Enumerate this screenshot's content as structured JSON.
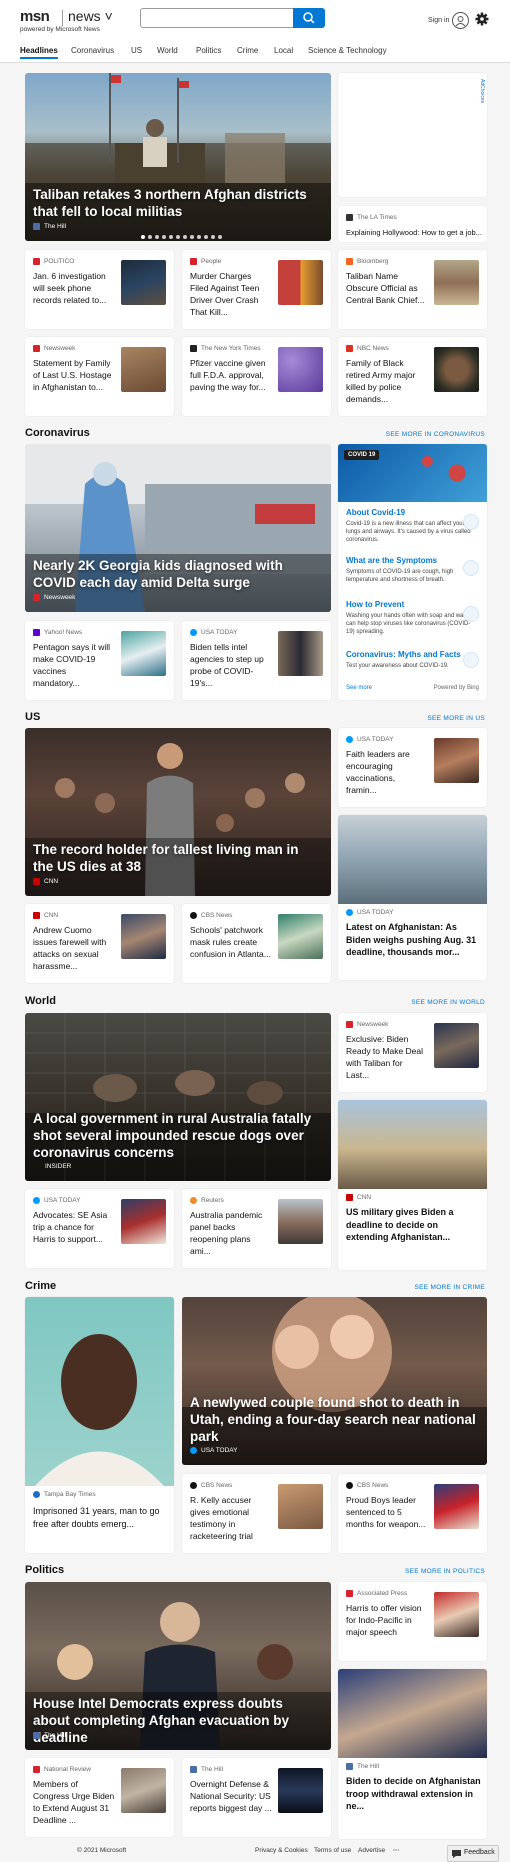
{
  "header": {
    "logo_msn": "msn",
    "logo_news": "news ˅",
    "powered": "powered by Microsoft News",
    "search_value": "",
    "signin": "Sign in"
  },
  "nav": [
    "Headlines",
    "Coronavirus",
    "US",
    "World",
    "Politics",
    "Crime",
    "Local",
    "Science & Technology"
  ],
  "ad_label": "AdChoices",
  "top": {
    "hero_title": "Taliban retakes 3 northern Afghan districts that fell to local militias",
    "hero_source": "The Hill",
    "side_source": "The LA Times",
    "side_title": "Explaining Hollywood: How to get a job...",
    "cards": [
      {
        "source": "POLITICO",
        "title": "Jan. 6 investigation will seek phone records related to..."
      },
      {
        "source": "People",
        "title": "Murder Charges Filed Against Teen Driver Over Crash That Kill..."
      },
      {
        "source": "Bloomberg",
        "title": "Taliban Name Obscure Official as Central Bank Chief..."
      },
      {
        "source": "Newsweek",
        "title": "Statement by Family of Last U.S. Hostage in Afghanistan to..."
      },
      {
        "source": "The New York Times",
        "title": "Pfizer vaccine given full F.D.A. approval, paving the way for..."
      },
      {
        "source": "NBC News",
        "title": "Family of Black retired Army major killed by police demands..."
      }
    ]
  },
  "coronavirus": {
    "heading": "Coronavirus",
    "see_more": "SEE MORE IN CORONAVIRUS",
    "hero_title": "Nearly 2K Georgia kids diagnosed with COVID each day amid Delta surge",
    "hero_source": "Newsweek",
    "panel": {
      "badge": "COVID 19",
      "items": [
        {
          "h": "About Covid-19",
          "p": "Covid-19 is a new illness that can affect your lungs and airways. It's caused by a virus called coronavirus."
        },
        {
          "h": "What are the Symptoms",
          "p": "Symptoms of COVID-19 are cough, high temperature and shortness of breath."
        },
        {
          "h": "How to Prevent",
          "p": "Washing your hands often with soap and water can help stop viruses like coronavirus (COVID-19) spreading."
        },
        {
          "h": "Coronavirus: Myths and Facts",
          "p": "Test your awareness about COVID-19."
        }
      ],
      "see_more": "See more",
      "powered": "Powered by Bing"
    },
    "cards": [
      {
        "source": "Yahoo! News",
        "title": "Pentagon says it will make COVID-19 vaccines mandatory..."
      },
      {
        "source": "USA TODAY",
        "title": "Biden tells intel agencies to step up probe of COVID-19's..."
      }
    ]
  },
  "us": {
    "heading": "US",
    "see_more": "SEE MORE IN US",
    "hero_title": "The record holder for tallest living man in the US dies at 38",
    "hero_source": "CNN",
    "side_card": {
      "source": "USA TODAY",
      "title": "Faith leaders are encouraging vaccinations, framin..."
    },
    "big_card": {
      "source": "USA TODAY",
      "title": "Latest on Afghanistan: As Biden weighs pushing Aug. 31 deadline, thousands mor..."
    },
    "cards": [
      {
        "source": "CNN",
        "title": "Andrew Cuomo issues farewell with attacks on sexual harassme..."
      },
      {
        "source": "CBS News",
        "title": "Schools' patchwork mask rules create confusion in Atlanta..."
      }
    ]
  },
  "world": {
    "heading": "World",
    "see_more": "SEE MORE IN WORLD",
    "hero_title": "A local government in rural Australia fatally shot several impounded rescue dogs over coronavirus concerns",
    "hero_source": "INSIDER",
    "side_card": {
      "source": "Newsweek",
      "title": "Exclusive: Biden Ready to Make Deal with Taliban for Last..."
    },
    "big_card": {
      "source": "CNN",
      "title": "US military gives Biden a deadline to decide on extending Afghanistan..."
    },
    "cards": [
      {
        "source": "USA TODAY",
        "title": "Advocates: SE Asia trip a chance for Harris to support..."
      },
      {
        "source": "Reuters",
        "title": "Australia pandemic panel backs reopening plans ami..."
      }
    ]
  },
  "crime": {
    "heading": "Crime",
    "see_more": "SEE MORE IN CRIME",
    "hero_title": "A newlywed couple found shot to death in Utah, ending a four-day search near national park",
    "hero_source": "USA TODAY",
    "left_card": {
      "source": "Tampa Bay Times",
      "title": "Imprisoned 31 years, man to go free after doubts emerg..."
    },
    "cards": [
      {
        "source": "CBS News",
        "title": "R. Kelly accuser gives emotional testimony in racketeering trial"
      },
      {
        "source": "CBS News",
        "title": "Proud Boys leader sentenced to 5 months for weapon..."
      }
    ]
  },
  "politics": {
    "heading": "Politics",
    "see_more": "SEE MORE IN POLITICS",
    "hero_title": "House Intel Democrats express doubts about completing Afghan evacuation by deadline",
    "hero_source": "The Hill",
    "side_card": {
      "source": "Associated Press",
      "title": "Harris to offer vision for Indo-Pacific in major speech"
    },
    "big_card": {
      "source": "The Hill",
      "title": "Biden to decide on Afghanistan troop withdrawal extension in ne..."
    },
    "cards": [
      {
        "source": "National Review",
        "title": "Members of Congress Urge Biden to Extend August 31 Deadline ..."
      },
      {
        "source": "The Hill",
        "title": "Overnight Defense & National Security: US reports biggest day ..."
      }
    ]
  },
  "footer": {
    "copyright": "© 2021 Microsoft",
    "privacy": "Privacy & Cookies",
    "terms": "Terms of use",
    "advertise": "Advertise",
    "more": "···",
    "feedback": "Feedback"
  }
}
